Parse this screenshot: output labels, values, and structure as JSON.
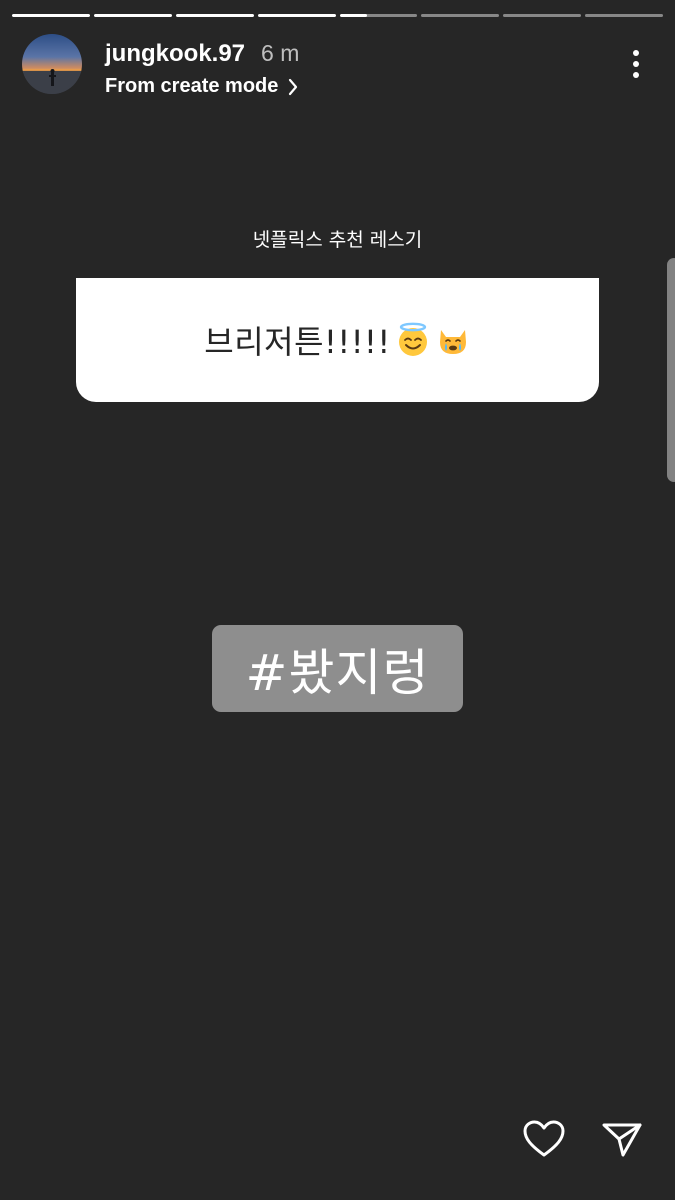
{
  "story": {
    "progress": [
      1,
      1,
      1,
      1,
      0.35,
      0,
      0,
      0
    ],
    "user": {
      "username": "jungkook.97",
      "time_ago": "6 m",
      "subtitle": "From create mode",
      "avatar_icon": "sunset-silhouette-avatar"
    },
    "question_sticker": {
      "label": "넷플릭스 추천 레스기",
      "answer": "브리저튼!!!!!",
      "emojis": [
        "smiling-face-with-halo",
        "crying-cat-face"
      ]
    },
    "hashtag": "#봤지렁",
    "actions": {
      "like_icon": "heart-icon",
      "share_icon": "send-icon"
    }
  },
  "colors": {
    "background": "#262626",
    "card": "#ffffff",
    "hashtag_bg": "#8e8e8e",
    "text_light": "#ffffff"
  }
}
